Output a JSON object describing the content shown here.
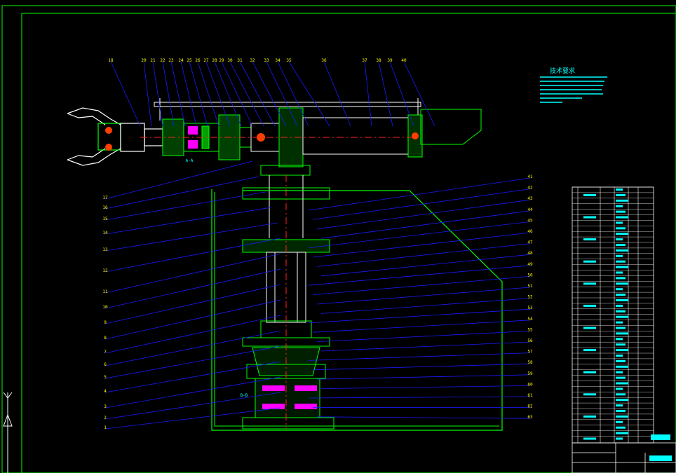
{
  "drawing": {
    "colors": {
      "background": "#000000",
      "outline": "#00ff00",
      "leader": "#1a1aff",
      "text": "#00ffff",
      "label": "#ffff00",
      "centerline": "#ff2020",
      "part": "#00c000",
      "fastener": "#ff00ff",
      "white": "#ffffff"
    },
    "notes_title": "技术要求",
    "top_labels": [
      "18",
      "20",
      "21",
      "22",
      "23",
      "24",
      "25",
      "26",
      "27",
      "28",
      "29",
      "30",
      "31",
      "32",
      "33",
      "34",
      "35",
      "36",
      "37",
      "38",
      "39",
      "40"
    ],
    "left_labels": [
      "17",
      "16",
      "15",
      "14",
      "13",
      "12",
      "11",
      "10",
      "9",
      "8",
      "7",
      "6",
      "5",
      "4",
      "3",
      "2",
      "1"
    ],
    "right_labels": [
      "41",
      "42",
      "43",
      "44",
      "45",
      "46",
      "47",
      "48",
      "49",
      "50",
      "51",
      "52",
      "53",
      "54",
      "55",
      "56",
      "57",
      "58",
      "59",
      "60",
      "61",
      "62",
      "63"
    ],
    "section_labels": [
      "A-A",
      "B-B"
    ],
    "axis_icon": "ucs-axis-icon"
  }
}
